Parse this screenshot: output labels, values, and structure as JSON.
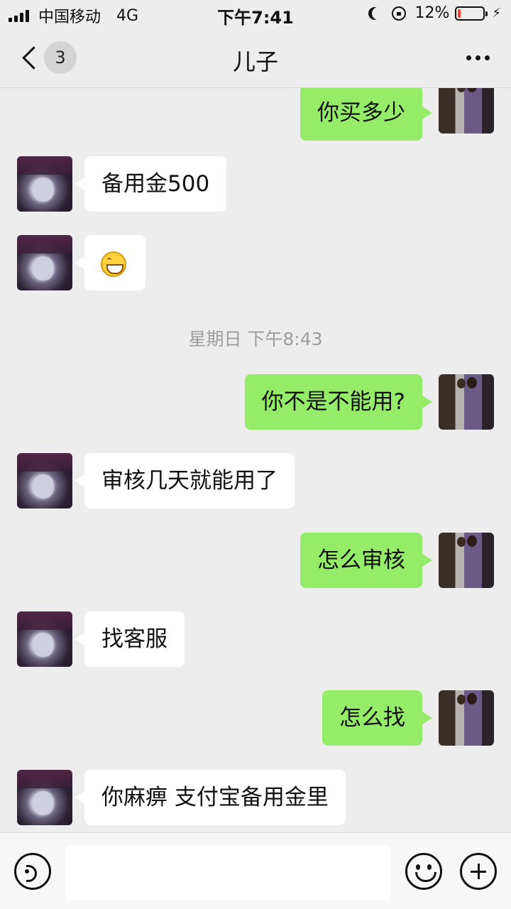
{
  "status_bar": {
    "carrier": "中国移动",
    "network": "4G",
    "time": "下午7:41",
    "battery_percent_label": "12%",
    "battery_level": 0.12,
    "icons": [
      "signal-icon",
      "moon-icon",
      "rotation-lock-icon",
      "battery-icon",
      "charging-icon"
    ]
  },
  "nav": {
    "back_badge": "3",
    "title": "儿子",
    "icons": [
      "back-chevron-icon",
      "more-dots-icon"
    ]
  },
  "messages": [
    {
      "side": "out",
      "text": "你买多少"
    },
    {
      "side": "in",
      "text": "备用金500"
    },
    {
      "side": "in",
      "emoji": "grin-emoji"
    },
    {
      "type": "timestamp",
      "text": "星期日 下午8:43"
    },
    {
      "side": "out",
      "text": "你不是不能用?"
    },
    {
      "side": "in",
      "text": "审核几天就能用了"
    },
    {
      "side": "out",
      "text": "怎么审核"
    },
    {
      "side": "in",
      "text": "找客服"
    },
    {
      "side": "out",
      "text": "怎么找"
    },
    {
      "side": "in",
      "text": "你麻痹 支付宝备用金里"
    }
  ],
  "input_bar": {
    "icons": [
      "voice-icon",
      "emoji-icon",
      "plus-icon"
    ],
    "text_value": ""
  },
  "colors": {
    "background": "#ededed",
    "outgoing_bubble": "#95ec69",
    "incoming_bubble": "#ffffff",
    "timestamp_text": "#9c9c9c",
    "battery_low": "#ff3b30"
  }
}
